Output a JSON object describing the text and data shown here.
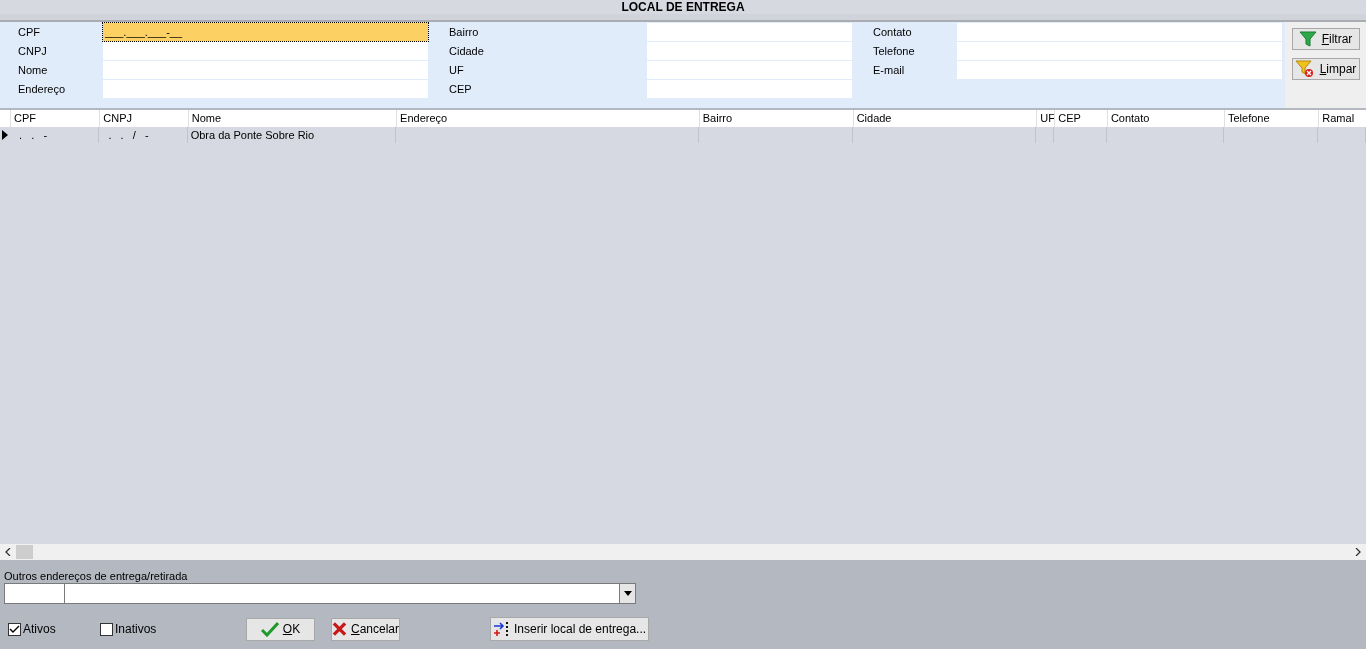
{
  "title": "LOCAL DE ENTREGA",
  "filters": [
    [
      {
        "label": "CPF",
        "value": "___.___.___-__",
        "focused": true
      },
      {
        "label": "CNPJ",
        "focused": false
      },
      {
        "label": "Nome",
        "focused": false
      },
      {
        "label": "Endereço",
        "focused": false
      }
    ],
    [
      {
        "label": "Bairro",
        "focused": false
      },
      {
        "label": "Cidade",
        "focused": false
      },
      {
        "label": "UF",
        "focused": false
      },
      {
        "label": "CEP",
        "focused": false
      }
    ],
    [
      {
        "label": "Contato",
        "focused": false
      },
      {
        "label": "Telefone",
        "focused": false
      },
      {
        "label": "E-mail",
        "focused": false
      }
    ]
  ],
  "filter_buttons": [
    {
      "kind": "filter",
      "label": "Filtrar"
    },
    {
      "kind": "clear",
      "label": "Limpar"
    }
  ],
  "table": {
    "columns": [
      "CPF",
      "CNPJ",
      "Nome",
      "Endereço",
      "Bairro",
      "Cidade",
      "UF",
      "CEP",
      "Contato",
      "Telefone",
      "Ramal"
    ],
    "rows": [
      {
        "selected": true,
        "cells": [
          ". . -",
          ". . / -",
          "Obra da Ponte Sobre Rio",
          null,
          null,
          null,
          null,
          null,
          null,
          null,
          null
        ]
      }
    ]
  },
  "other_addresses": {
    "label": "Outros endereços de entrega/retirada"
  },
  "checkboxes": [
    {
      "label": "Ativos",
      "checked": true
    },
    {
      "label": "Inativos",
      "checked": false
    }
  ],
  "buttons": [
    {
      "kind": "ok",
      "label": "OK"
    },
    {
      "kind": "cancel",
      "label": "Cancelar"
    },
    {
      "kind": "insert",
      "label": "Inserir local de entrega..."
    }
  ]
}
